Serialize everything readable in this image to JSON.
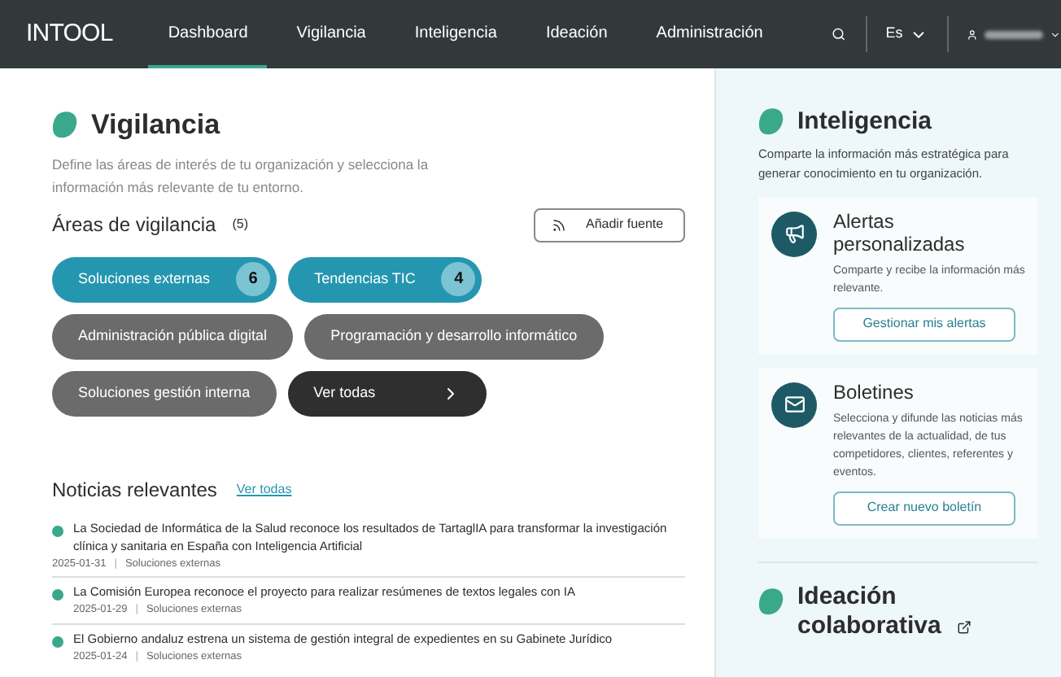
{
  "nav": {
    "logo": "INTOOL",
    "items": [
      {
        "label": "Dashboard",
        "selected": true
      },
      {
        "label": "Vigilancia",
        "selected": false
      },
      {
        "label": "Inteligencia",
        "selected": false
      },
      {
        "label": "Ideación",
        "selected": false
      },
      {
        "label": "Administración",
        "selected": false
      }
    ],
    "language": "Es"
  },
  "vigilancia": {
    "title": "Vigilancia",
    "description": "Define las áreas de interés de tu organización y selecciona la información más relevante de tu entorno.",
    "areas_title": "Áreas de vigilancia",
    "areas_count": "(5)",
    "add_button": "Añadir fuente",
    "chips": [
      {
        "label": "Soluciones externas",
        "kind": "selected",
        "count": "6"
      },
      {
        "label": "Tendencias TIC",
        "kind": "selected",
        "count": "4"
      },
      {
        "label": "Administración pública digital",
        "kind": "area"
      },
      {
        "label": "Programación y desarrollo informático",
        "kind": "area"
      },
      {
        "label": "Soluciones gestión interna",
        "kind": "area"
      },
      {
        "label": "Ver todas",
        "kind": "more"
      }
    ]
  },
  "news": {
    "title": "Noticias relevantes",
    "link": "Ver todas",
    "separator": "|",
    "items": [
      {
        "title": "La Sociedad de Informática de la Salud reconoce los resultados de TartaglIA para transformar la investigación clínica y sanitaria en España con Inteligencia Artificial",
        "date": "2025-01-31",
        "area": "Soluciones externas"
      },
      {
        "title": "La Comisión Europea reconoce el proyecto para realizar resúmenes de textos legales con IA",
        "date": "2025-01-29",
        "area": "Soluciones externas"
      },
      {
        "title": "El Gobierno andaluz estrena un sistema de gestión integral de expedientes en su Gabinete Jurídico",
        "date": "2025-01-24",
        "area": "Soluciones externas"
      }
    ]
  },
  "inteligencia": {
    "title": "Inteligencia",
    "description": "Comparte la información más estratégica para generar conocimiento en tu organización.",
    "cards": [
      {
        "kind": "alerts",
        "title": "Alertas personalizadas",
        "text": "Comparte y recibe la información más relevante.",
        "button": "Gestionar mis alertas"
      },
      {
        "kind": "newsletter",
        "title": "Boletines",
        "text": "Selecciona y difunde las noticias más relevantes de la actualidad, de tus competidores, clientes, referentes y eventos.",
        "button": "Crear nuevo boletín"
      }
    ]
  },
  "ideacion": {
    "title": "Ideación colaborativa"
  }
}
